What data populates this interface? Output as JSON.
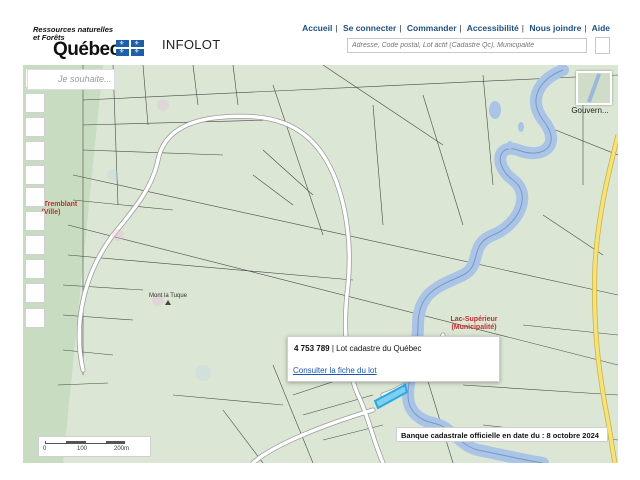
{
  "header": {
    "org_line1": "Ressources naturelles",
    "org_line2": "et Forêts",
    "brand": "Québec",
    "app_title": "INFOLOT"
  },
  "nav": {
    "items": [
      "Accueil",
      "Se connecter",
      "Commander",
      "Accessibilité",
      "Nous joindre",
      "Aide"
    ]
  },
  "search": {
    "placeholder": "Adresse, Code postal, Lot actif (Cadastre Qc), Municipalité"
  },
  "map": {
    "wish_placeholder": "Je souhaite...",
    "basemap_label": "Gouvern...",
    "labels": {
      "city_left": "Mont-Tremblant",
      "city_left_type": "(Ville)",
      "lake_name": "Lac-Supérieur",
      "lake_type": "(Municipalité)",
      "peak": "Mont la Tuque"
    }
  },
  "popup": {
    "lot_number": "4 753 789",
    "lot_desc": " | Lot cadastre du Québec",
    "link": "Consulter la fiche du lot"
  },
  "footer": {
    "date_banner": "Banque cadastrale officielle en date du : 8 octobre 2024"
  },
  "scale": {
    "ticks": [
      "0",
      "100",
      "200m"
    ]
  },
  "colors": {
    "map_bg": "#dbe6d4",
    "water": "#a9c4e6",
    "road": "#ffffff",
    "highway": "#f5e37a",
    "nav_link": "#1d4f7f",
    "label_red": "#c03030",
    "selected_lot": "#2aa8e0"
  }
}
